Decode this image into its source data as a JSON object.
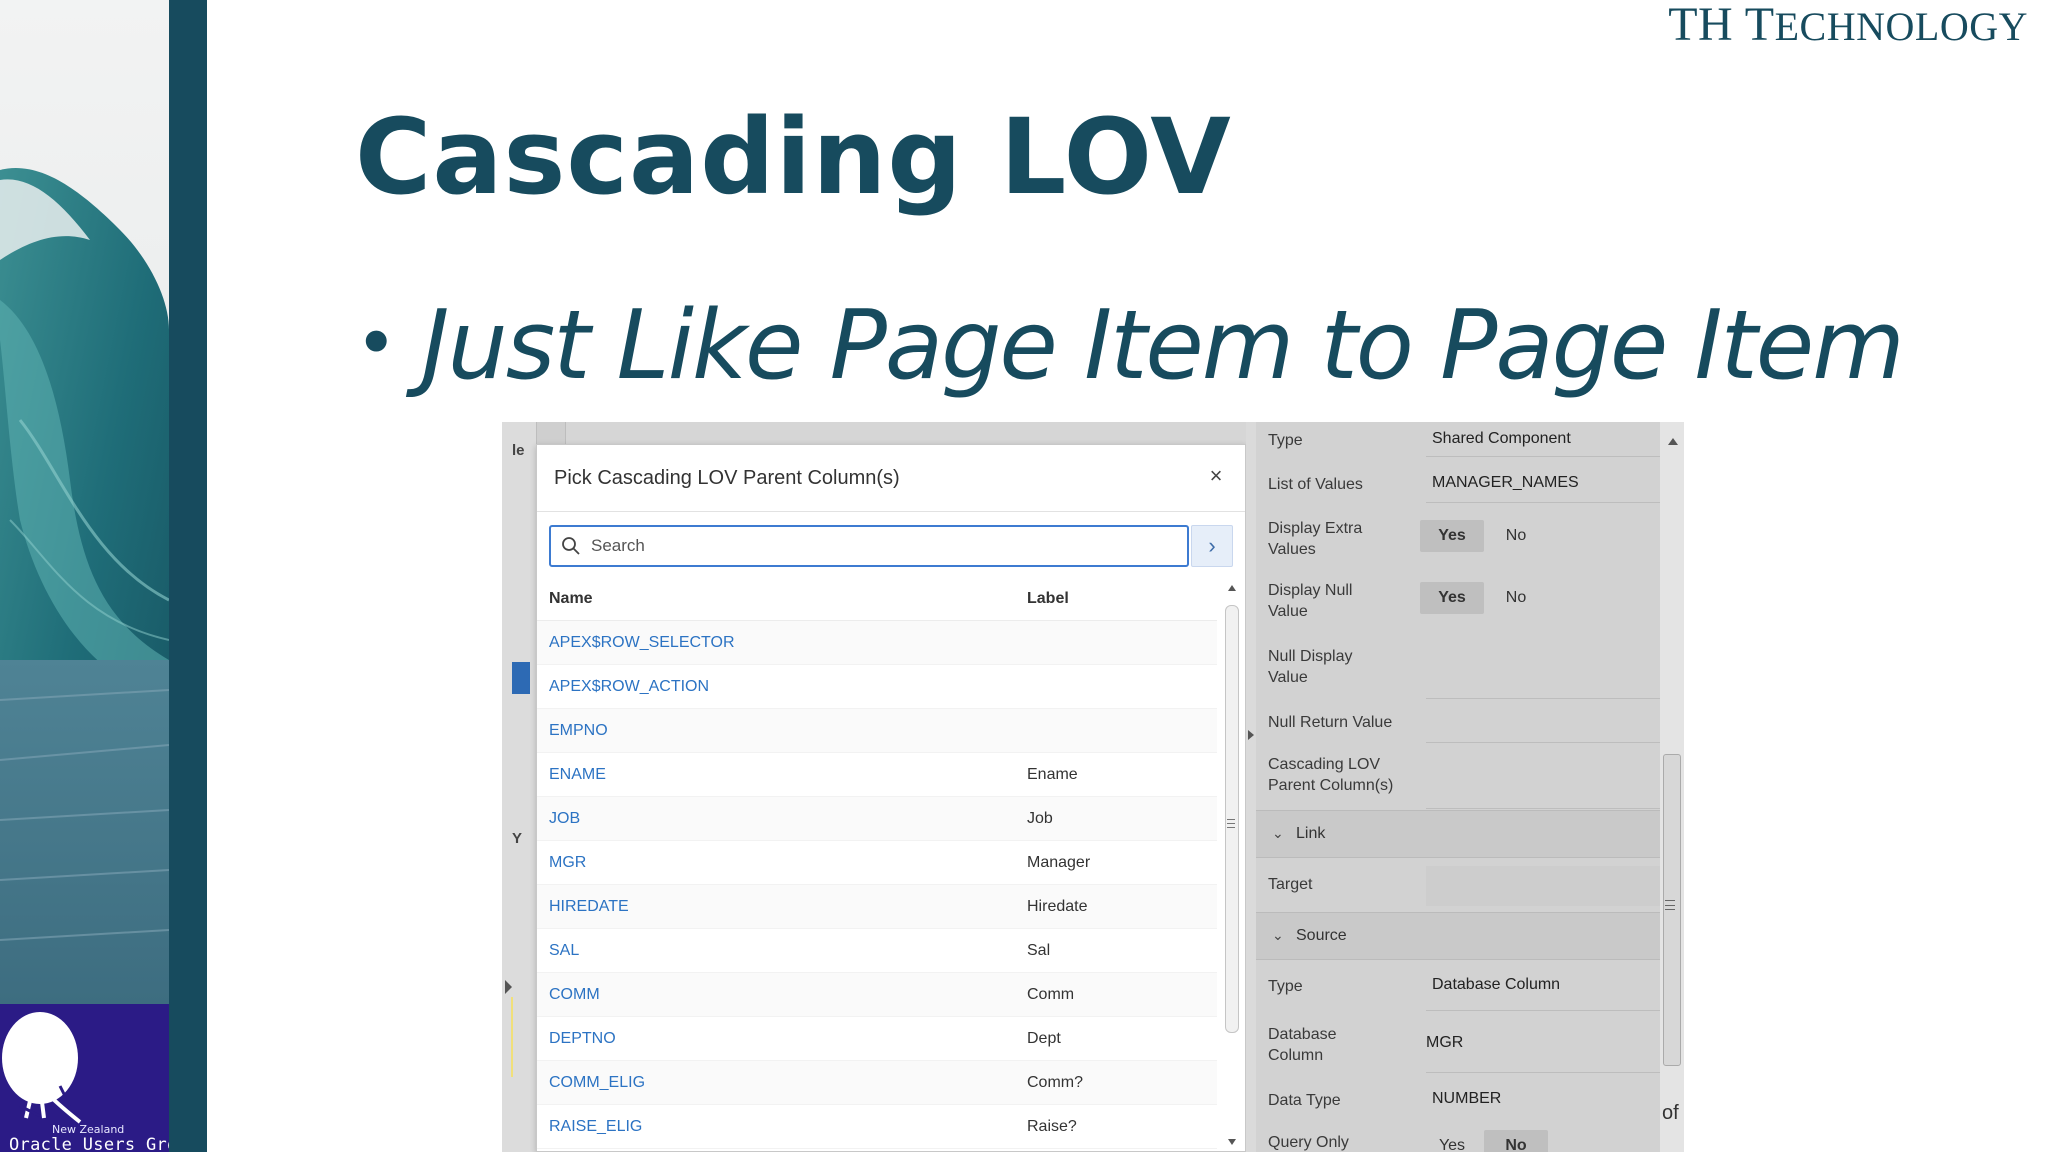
{
  "brand": {
    "text_large": "TH T",
    "text_small": "ECHNOLOGY"
  },
  "slide": {
    "title": "Cascading LOV",
    "bullet": "Just Like Page Item to Page Item"
  },
  "logo": {
    "line_small": "New Zealand",
    "line_main": "Oracle Users Group"
  },
  "screenshot": {
    "left_fragments": {
      "top": "le",
      "mid": "Y"
    },
    "dialog": {
      "title": "Pick Cascading LOV Parent Column(s)",
      "close_glyph": "×",
      "search": {
        "placeholder": "Search",
        "value": ""
      },
      "go_glyph": "›",
      "columns": {
        "name": "Name",
        "label": "Label"
      },
      "rows": [
        {
          "name": "APEX$ROW_SELECTOR",
          "label": ""
        },
        {
          "name": "APEX$ROW_ACTION",
          "label": ""
        },
        {
          "name": "EMPNO",
          "label": ""
        },
        {
          "name": "ENAME",
          "label": "Ename"
        },
        {
          "name": "JOB",
          "label": "Job"
        },
        {
          "name": "MGR",
          "label": "Manager"
        },
        {
          "name": "HIREDATE",
          "label": "Hiredate"
        },
        {
          "name": "SAL",
          "label": "Sal"
        },
        {
          "name": "COMM",
          "label": "Comm"
        },
        {
          "name": "DEPTNO",
          "label": "Dept"
        },
        {
          "name": "COMM_ELIG",
          "label": "Comm?"
        },
        {
          "name": "RAISE_ELIG",
          "label": "Raise?"
        }
      ]
    },
    "properties": {
      "type": {
        "label": "Type",
        "value": "Shared Component"
      },
      "list_of_values": {
        "label": "List of Values",
        "value": "MANAGER_NAMES"
      },
      "display_extra": {
        "label_1": "Display Extra",
        "label_2": "Values",
        "yes": "Yes",
        "no": "No"
      },
      "display_null": {
        "label_1": "Display Null",
        "label_2": "Value",
        "yes": "Yes",
        "no": "No"
      },
      "null_display": {
        "label_1": "Null Display",
        "label_2": "Value"
      },
      "null_return": {
        "label": "Null Return Value"
      },
      "cascading_parent": {
        "label_1": "Cascading LOV",
        "label_2": "Parent Column(s)"
      },
      "link_section": {
        "chevron": "⌄",
        "label": "Link"
      },
      "target": {
        "label": "Target"
      },
      "source_section": {
        "chevron": "⌄",
        "label": "Source"
      },
      "source_type": {
        "label": "Type",
        "value": "Database Column"
      },
      "database_column": {
        "label_1": "Database",
        "label_2": "Column",
        "value": "MGR"
      },
      "data_type": {
        "label": "Data Type",
        "value": "NUMBER"
      },
      "query_only": {
        "label": "Query Only",
        "yes": "Yes",
        "no": "No"
      }
    },
    "right_fragment": "of '"
  }
}
